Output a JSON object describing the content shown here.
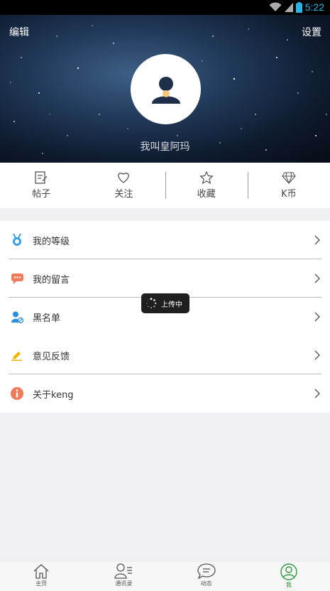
{
  "status_bar": {
    "time": "5:22"
  },
  "header": {
    "edit_label": "编辑",
    "settings_label": "设置",
    "username": "我叫皇阿玛"
  },
  "stats": [
    {
      "label": "帖子",
      "icon": "post-icon"
    },
    {
      "label": "关注",
      "icon": "heart-icon"
    },
    {
      "label": "收藏",
      "icon": "star-icon"
    },
    {
      "label": "K币",
      "icon": "diamond-icon"
    }
  ],
  "menu": [
    {
      "label": "我的等级",
      "icon": "medal-icon",
      "color": "#3aa0e8"
    },
    {
      "label": "我的留言",
      "icon": "message-icon",
      "color": "#f07a5a"
    },
    {
      "label": "黑名单",
      "icon": "blocked-user-icon",
      "color": "#2a8ee0"
    },
    {
      "label": "意见反馈",
      "icon": "pencil-icon",
      "color": "#f1b400"
    },
    {
      "label": "关于keng",
      "icon": "info-icon",
      "color": "#f07a5a"
    }
  ],
  "toast": {
    "label": "上传中"
  },
  "bottom_nav": [
    {
      "label": "主页",
      "icon": "home-icon"
    },
    {
      "label": "通讯录",
      "icon": "contacts-icon"
    },
    {
      "label": "动态",
      "icon": "chat-icon"
    },
    {
      "label": "我",
      "icon": "profile-icon",
      "active": true
    }
  ],
  "colors": {
    "accent": "#2d9a3c",
    "status_blue": "#27b5e6"
  }
}
